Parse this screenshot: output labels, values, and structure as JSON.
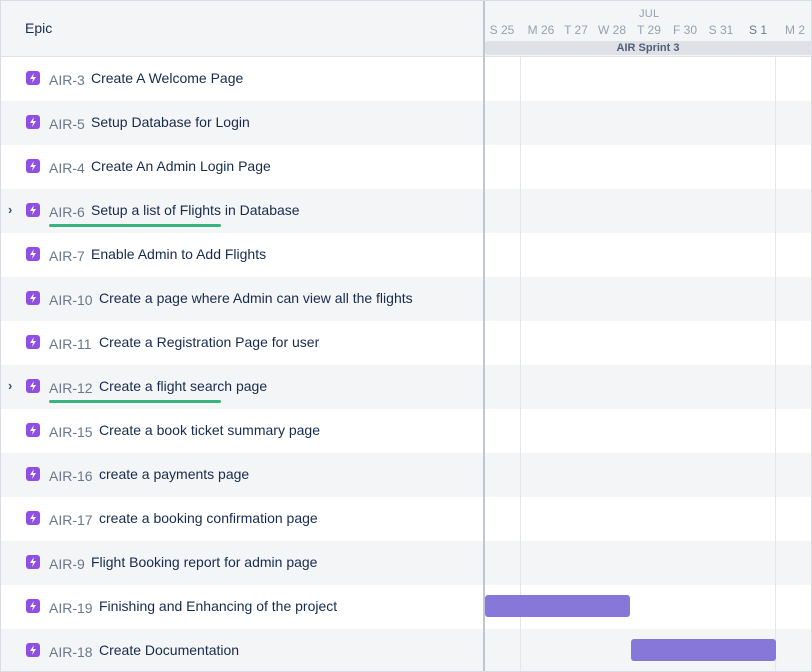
{
  "header": {
    "epic_column_title": "Epic",
    "month": "JUL",
    "days": [
      "S 25",
      "M 26",
      "T 27",
      "W 28",
      "T 29",
      "F 30",
      "S 31",
      "S 1",
      "M 2"
    ],
    "sprint_label": "AIR Sprint 3"
  },
  "epics": [
    {
      "key": "AIR-3",
      "summary": "Create A Welcome Page",
      "expandable": false,
      "progress": false,
      "icon": "epic-icon"
    },
    {
      "key": "AIR-5",
      "summary": "Setup Database for Login",
      "expandable": false,
      "progress": false,
      "icon": "epic-icon"
    },
    {
      "key": "AIR-4",
      "summary": "Create An Admin Login Page",
      "expandable": false,
      "progress": false,
      "icon": "epic-icon"
    },
    {
      "key": "AIR-6",
      "summary": "Setup a list of Flights in Database",
      "expandable": true,
      "progress": true,
      "icon": "epic-icon"
    },
    {
      "key": "AIR-7",
      "summary": "Enable Admin to Add Flights",
      "expandable": false,
      "progress": false,
      "icon": "epic-icon"
    },
    {
      "key": "AIR-10",
      "summary": "Create a page where Admin can view all the flights",
      "expandable": false,
      "progress": false,
      "icon": "epic-icon"
    },
    {
      "key": "AIR-11",
      "summary": "Create a Registration Page for user",
      "expandable": false,
      "progress": false,
      "icon": "epic-icon"
    },
    {
      "key": "AIR-12",
      "summary": "Create a flight search page",
      "expandable": true,
      "progress": true,
      "icon": "epic-icon"
    },
    {
      "key": "AIR-15",
      "summary": "Create a book ticket summary page",
      "expandable": false,
      "progress": false,
      "icon": "epic-icon"
    },
    {
      "key": "AIR-16",
      "summary": "create a payments page",
      "expandable": false,
      "progress": false,
      "icon": "epic-icon"
    },
    {
      "key": "AIR-17",
      "summary": "create a booking confirmation page",
      "expandable": false,
      "progress": false,
      "icon": "epic-icon"
    },
    {
      "key": "AIR-9",
      "summary": "Flight Booking report for admin page",
      "expandable": false,
      "progress": false,
      "icon": "epic-icon"
    },
    {
      "key": "AIR-19",
      "summary": "Finishing and Enhancing of the project",
      "expandable": false,
      "progress": false,
      "icon": "epic-icon"
    },
    {
      "key": "AIR-18",
      "summary": "Create Documentation",
      "expandable": false,
      "progress": false,
      "icon": "epic-icon"
    }
  ],
  "colors": {
    "epic_icon": "#904ee2",
    "progress": "#36b37e",
    "timeline_bar": "#8777d9"
  }
}
